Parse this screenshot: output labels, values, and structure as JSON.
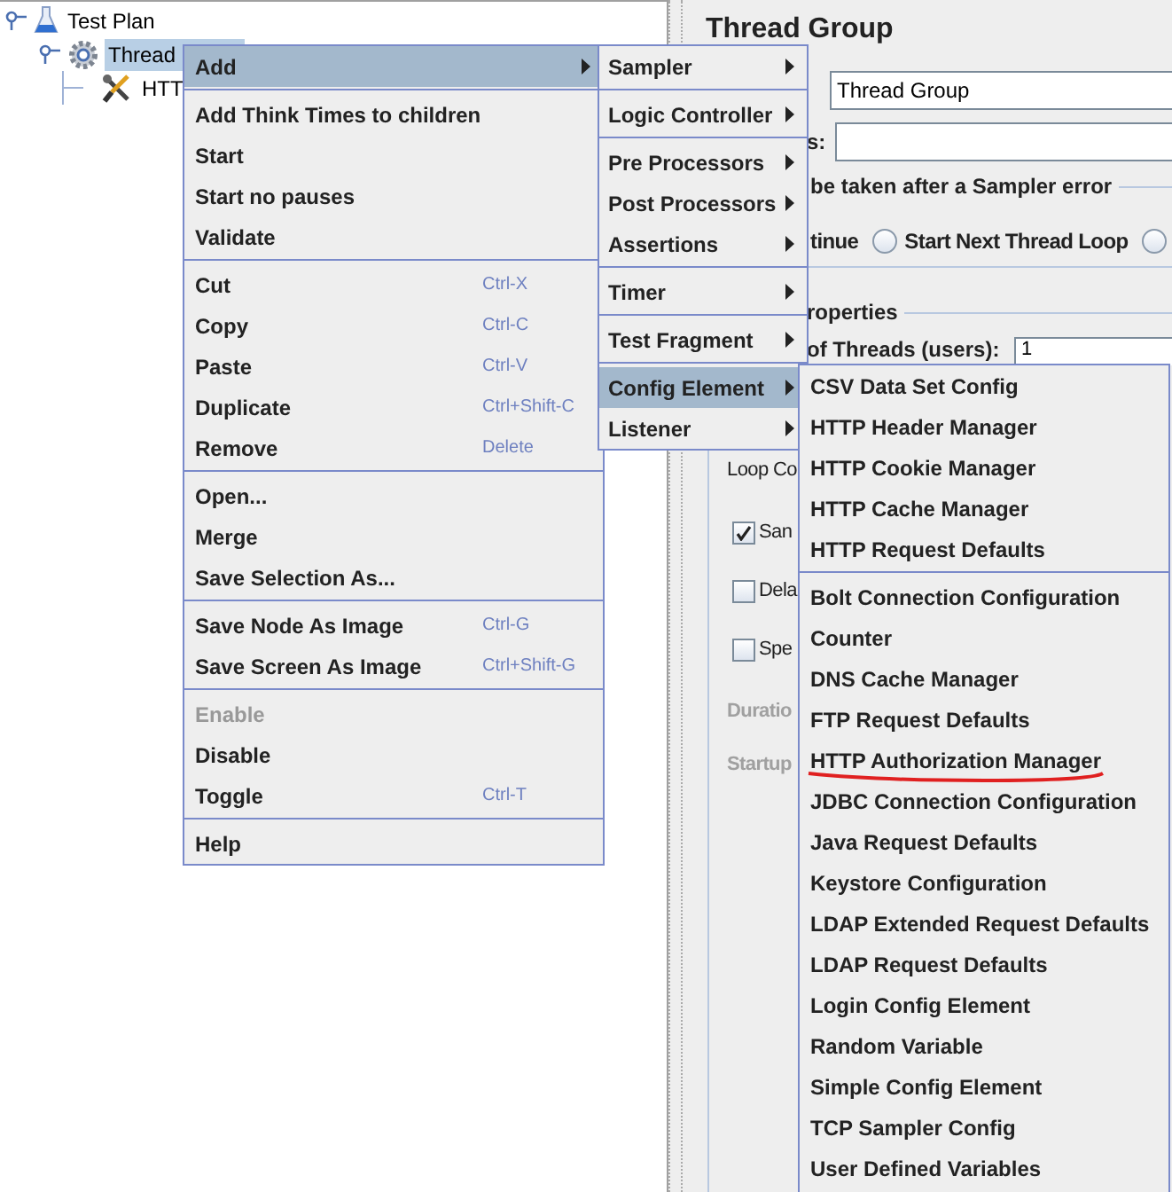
{
  "tree": [
    {
      "label": "Test Plan",
      "kind": "plan",
      "selected": false,
      "expanded": true,
      "children": [
        {
          "label": "Thread",
          "kind": "thread_group",
          "selected": true,
          "expanded": true,
          "children": [
            {
              "label": "HTT",
              "kind": "config",
              "selected": false
            }
          ]
        }
      ]
    }
  ],
  "panel": {
    "title": "Thread Group",
    "name_field": {
      "value": "Thread Group"
    },
    "comments_label": "s:",
    "error_heading": "be taken after a Sampler error",
    "error_options": [
      {
        "label": "tinue"
      },
      {
        "label": "Start Next Thread Loop",
        "selected": false
      },
      {
        "selected": false
      }
    ],
    "properties_heading": "roperties",
    "threads_label": "of Threads (users):",
    "threads_value": "1",
    "loop_label": "Loop Co",
    "checkboxes": [
      {
        "label": "San",
        "checked": true
      },
      {
        "label": "Dela",
        "checked": false
      },
      {
        "label": "Spe",
        "checked": false
      }
    ],
    "disabled_labels": [
      "Duratio",
      "Startup"
    ]
  },
  "menus": [
    {
      "groups": [
        [
          {
            "label": "Add",
            "selected": true,
            "disabled": false,
            "submenu": true
          }
        ],
        [
          {
            "label": "Add Think Times to children",
            "selected": false,
            "disabled": false,
            "submenu": false
          },
          {
            "label": "Start",
            "selected": false,
            "disabled": false,
            "submenu": false
          },
          {
            "label": "Start no pauses",
            "selected": false,
            "disabled": false,
            "submenu": false
          },
          {
            "label": "Validate",
            "selected": false,
            "disabled": false,
            "submenu": false
          }
        ],
        [
          {
            "label": "Cut",
            "shortcut": "Ctrl-X",
            "selected": false,
            "disabled": false,
            "submenu": false
          },
          {
            "label": "Copy",
            "shortcut": "Ctrl-C",
            "selected": false,
            "disabled": false,
            "submenu": false
          },
          {
            "label": "Paste",
            "shortcut": "Ctrl-V",
            "selected": false,
            "disabled": false,
            "submenu": false
          },
          {
            "label": "Duplicate",
            "shortcut": "Ctrl+Shift-C",
            "selected": false,
            "disabled": false,
            "submenu": false
          },
          {
            "label": "Remove",
            "shortcut": "Delete",
            "selected": false,
            "disabled": false,
            "submenu": false
          }
        ],
        [
          {
            "label": "Open...",
            "selected": false,
            "disabled": false,
            "submenu": false
          },
          {
            "label": "Merge",
            "selected": false,
            "disabled": false,
            "submenu": false
          },
          {
            "label": "Save Selection As...",
            "selected": false,
            "disabled": false,
            "submenu": false
          }
        ],
        [
          {
            "label": "Save Node As Image",
            "shortcut": "Ctrl-G",
            "selected": false,
            "disabled": false,
            "submenu": false
          },
          {
            "label": "Save Screen As Image",
            "shortcut": "Ctrl+Shift-G",
            "selected": false,
            "disabled": false,
            "submenu": false
          }
        ],
        [
          {
            "label": "Enable",
            "selected": false,
            "disabled": true,
            "submenu": false
          },
          {
            "label": "Disable",
            "selected": false,
            "disabled": false,
            "submenu": false
          },
          {
            "label": "Toggle",
            "shortcut": "Ctrl-T",
            "selected": false,
            "disabled": false,
            "submenu": false
          }
        ],
        [
          {
            "label": "Help",
            "selected": false,
            "disabled": false,
            "submenu": false
          }
        ]
      ]
    },
    {
      "groups": [
        [
          {
            "label": "Sampler",
            "selected": false,
            "submenu": true
          }
        ],
        [
          {
            "label": "Logic Controller",
            "selected": false,
            "submenu": true
          }
        ],
        [
          {
            "label": "Pre Processors",
            "selected": false,
            "submenu": true
          },
          {
            "label": "Post Processors",
            "selected": false,
            "submenu": true
          },
          {
            "label": "Assertions",
            "selected": false,
            "submenu": true
          }
        ],
        [
          {
            "label": "Timer",
            "selected": false,
            "submenu": true
          }
        ],
        [
          {
            "label": "Test Fragment",
            "selected": false,
            "submenu": true
          }
        ],
        [
          {
            "label": "Config Element",
            "selected": true,
            "submenu": true
          },
          {
            "label": "Listener",
            "selected": false,
            "submenu": true
          }
        ]
      ]
    },
    {
      "groups": [
        [
          {
            "label": "CSV Data Set Config",
            "selected": false,
            "underlined": false
          },
          {
            "label": "HTTP Header Manager",
            "selected": false,
            "underlined": false
          },
          {
            "label": "HTTP Cookie Manager",
            "selected": false,
            "underlined": false
          },
          {
            "label": "HTTP Cache Manager",
            "selected": false,
            "underlined": false
          },
          {
            "label": "HTTP Request Defaults",
            "selected": false,
            "underlined": false
          }
        ],
        [
          {
            "label": "Bolt Connection Configuration",
            "selected": false,
            "underlined": false
          },
          {
            "label": "Counter",
            "selected": false,
            "underlined": false
          },
          {
            "label": "DNS Cache Manager",
            "selected": false,
            "underlined": false
          },
          {
            "label": "FTP Request Defaults",
            "selected": false,
            "underlined": false
          },
          {
            "label": "HTTP Authorization Manager",
            "selected": false,
            "underlined": true
          },
          {
            "label": "JDBC Connection Configuration",
            "selected": false,
            "underlined": false
          },
          {
            "label": "Java Request Defaults",
            "selected": false,
            "underlined": false
          },
          {
            "label": "Keystore Configuration",
            "selected": false,
            "underlined": false
          },
          {
            "label": "LDAP Extended Request Defaults",
            "selected": false,
            "underlined": false
          },
          {
            "label": "LDAP Request Defaults",
            "selected": false,
            "underlined": false
          },
          {
            "label": "Login Config Element",
            "selected": false,
            "underlined": false
          },
          {
            "label": "Random Variable",
            "selected": false,
            "underlined": false
          },
          {
            "label": "Simple Config Element",
            "selected": false,
            "underlined": false
          },
          {
            "label": "TCP Sampler Config",
            "selected": false,
            "underlined": false
          },
          {
            "label": "User Defined Variables",
            "selected": false,
            "underlined": false
          }
        ]
      ]
    }
  ]
}
